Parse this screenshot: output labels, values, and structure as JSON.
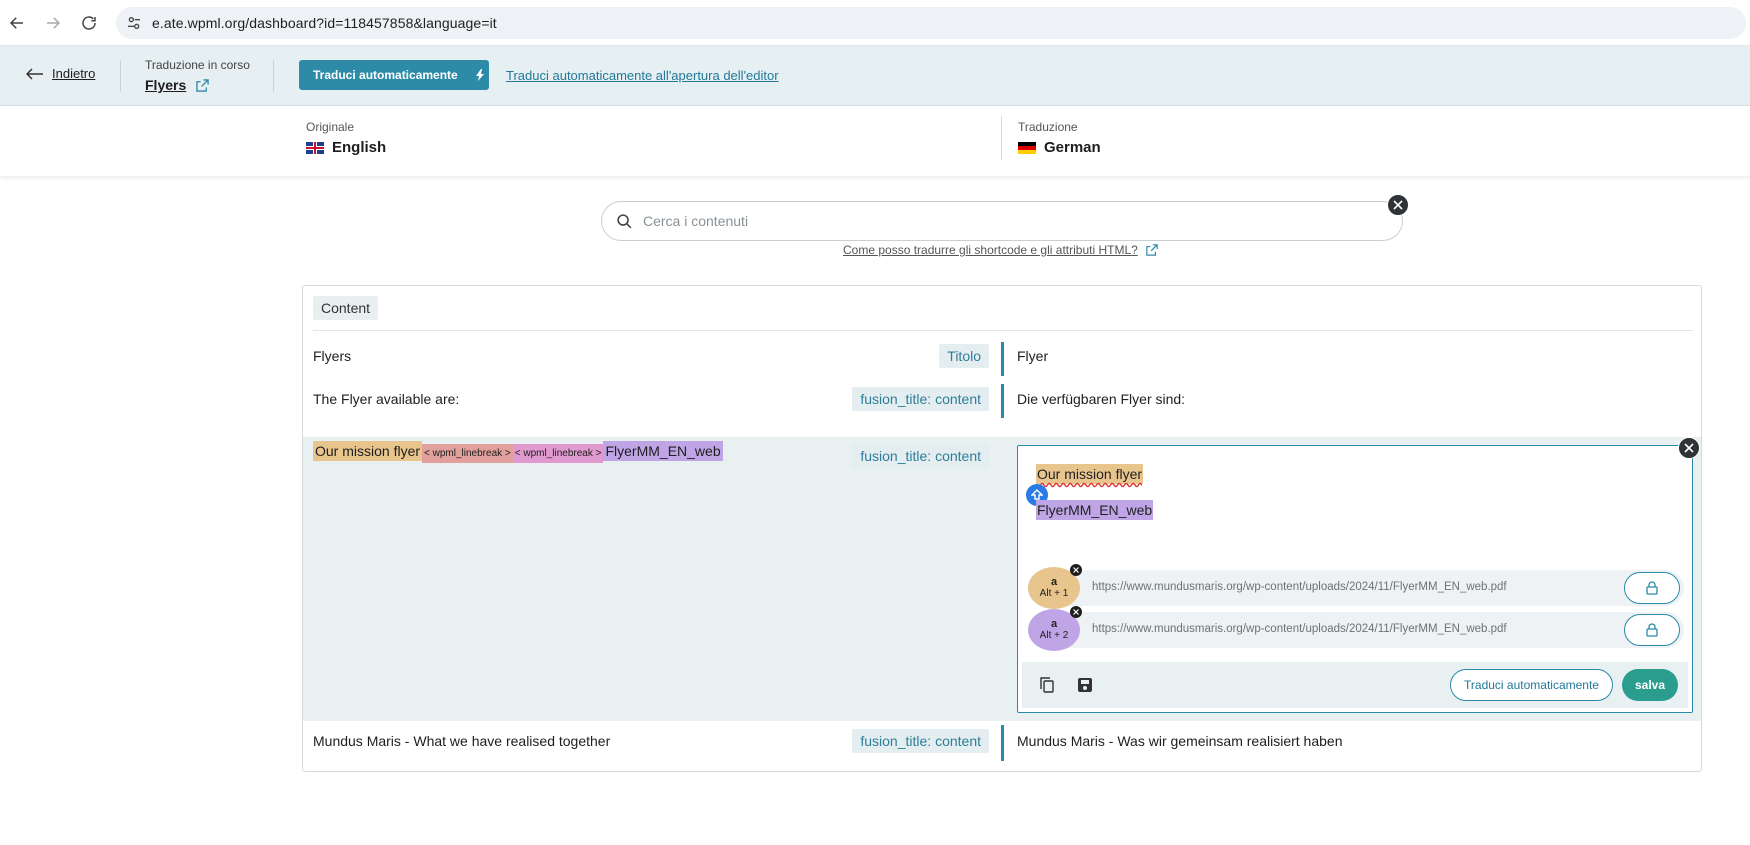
{
  "browser": {
    "url": "e.ate.wpml.org/dashboard?id=118457858&language=it"
  },
  "header": {
    "back_label": "Indietro",
    "status_label": "Traduzione in corso",
    "document_title": "Flyers",
    "auto_translate_button": "Traduci automaticamente",
    "auto_translate_link": "Traduci automaticamente all'apertura dell'editor"
  },
  "languages": {
    "original_label": "Originale",
    "original_name": "English",
    "translation_label": "Traduzione",
    "translation_name": "German"
  },
  "search": {
    "placeholder": "Cerca i contenuti",
    "help_link": "Come posso tradurre gli shortcode e gli attributi HTML?"
  },
  "panel": {
    "section_tag": "Content",
    "rows": [
      {
        "source": "Flyers",
        "badge": "Titolo",
        "target": "Flyer"
      },
      {
        "source": "The Flyer available are:",
        "badge": "fusion_title: content",
        "target": "Die verfügbaren Flyer sind:"
      },
      {
        "source_segments": {
          "a": "Our mission flyer",
          "lb1": "< wpml_linebreak >",
          "lb2": "< wpml_linebreak >",
          "b": "FlyerMM_EN_web"
        },
        "badge": "fusion_title: content"
      },
      {
        "source": "Mundus Maris - What we have realised together",
        "badge": "fusion_title: content",
        "target": "Mundus Maris - Was wir gemeinsam realisiert haben"
      }
    ]
  },
  "editor": {
    "line1": "Our mission flyer",
    "line2": "FlyerMM_EN_web",
    "attributes": [
      {
        "key": "a",
        "shortcut": "Alt + 1",
        "value": "https://www.mundusmaris.org/wp-content/uploads/2024/11/FlyerMM_EN_web.pdf",
        "color": "#e8c58d"
      },
      {
        "key": "a",
        "shortcut": "Alt + 2",
        "value": "https://www.mundusmaris.org/wp-content/uploads/2024/11/FlyerMM_EN_web.pdf",
        "color": "#bfa5e6"
      }
    ],
    "auto_translate_button": "Traduci automaticamente",
    "save_button": "salva"
  },
  "colors": {
    "accent": "#2a8aa7",
    "save": "#2a9d8f",
    "tag_a": "#e8c58d",
    "tag_b": "#bfa5e6",
    "linebreak_1": "#e2a09d",
    "linebreak_2": "#e09ad0"
  }
}
